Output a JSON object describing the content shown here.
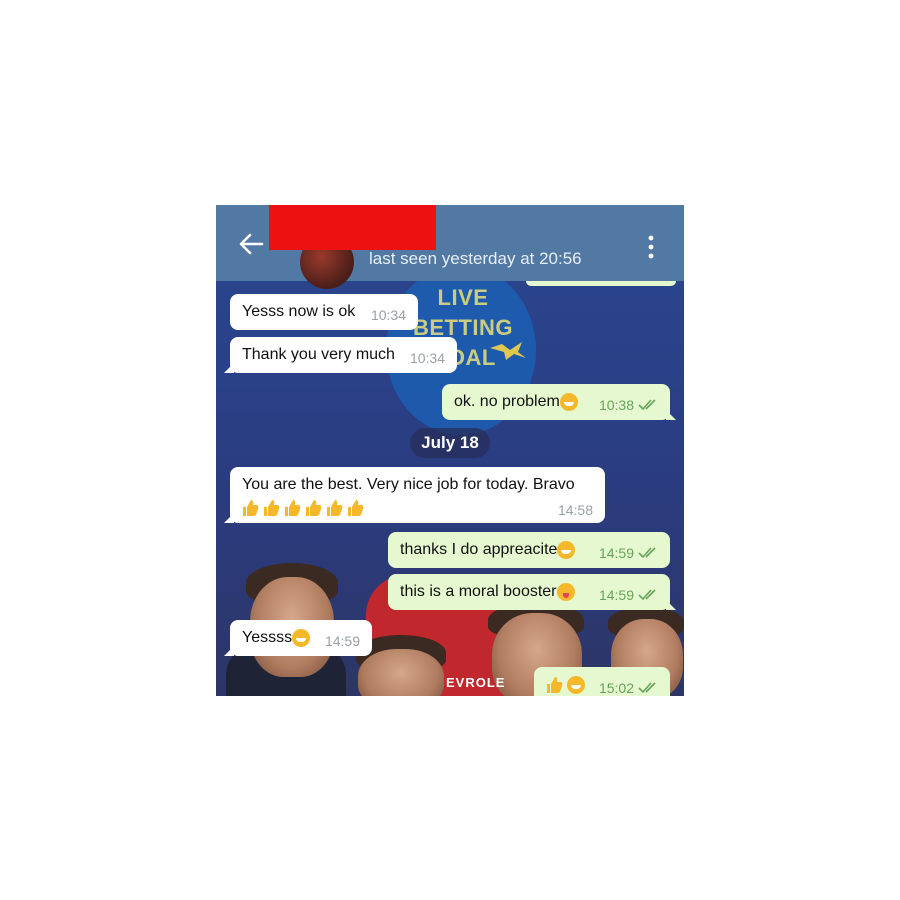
{
  "header": {
    "status": "last seen yesterday at 20:56"
  },
  "wallpaper": {
    "logo_text": "LIVE BETTING GOAL",
    "sponsor": "EVROLE"
  },
  "messages": [
    {
      "side": "in",
      "text": "Yesss now is ok",
      "time": "10:34"
    },
    {
      "side": "in",
      "text": "Thank you very much",
      "time": "10:34"
    },
    {
      "side": "out",
      "text": "ok. no problem",
      "emoji": "grin",
      "time": "10:38",
      "read": true
    },
    {
      "side": "in",
      "text": "You are the best. Very nice job for today. Bravo",
      "emoji": "thumbs-up x6",
      "time": "14:58"
    },
    {
      "side": "out",
      "text": "thanks I do appreacite",
      "emoji": "grin",
      "time": "14:59",
      "read": true
    },
    {
      "side": "out",
      "text": "this is a moral booster",
      "emoji": "tongue",
      "time": "14:59",
      "read": true
    },
    {
      "side": "in",
      "text": "Yessss",
      "emoji": "grin",
      "time": "14:59"
    },
    {
      "side": "out",
      "text": "",
      "emoji": "thumbs-up, grin",
      "time": "15:02",
      "read": true
    }
  ],
  "date_separator": "July 18",
  "colors": {
    "header": "#5279a3",
    "incoming_bubble": "#ffffff",
    "outgoing_bubble": "#e6f8cf",
    "outgoing_time": "#66a35a",
    "redaction": "#ee1111"
  }
}
